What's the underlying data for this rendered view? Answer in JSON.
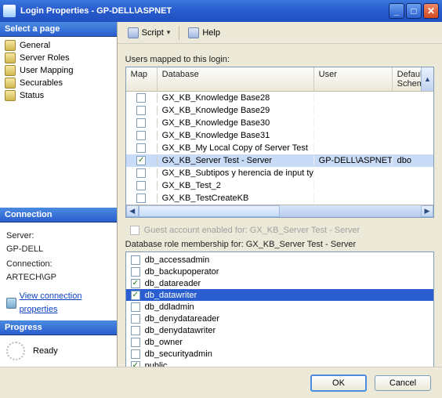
{
  "window": {
    "title": "Login Properties - GP-DELL\\ASPNET"
  },
  "sidebar": {
    "select_header": "Select a page",
    "items": [
      {
        "label": "General"
      },
      {
        "label": "Server Roles"
      },
      {
        "label": "User Mapping"
      },
      {
        "label": "Securables"
      },
      {
        "label": "Status"
      }
    ],
    "connection": {
      "header": "Connection",
      "server_label": "Server:",
      "server_value": "GP-DELL",
      "conn_label": "Connection:",
      "conn_value": "ARTECH\\GP",
      "view_props": "View connection properties"
    },
    "progress": {
      "header": "Progress",
      "status": "Ready"
    }
  },
  "toolbar": {
    "script": "Script",
    "help": "Help"
  },
  "main": {
    "mapped_label": "Users mapped to this login:",
    "columns": {
      "map": "Map",
      "database": "Database",
      "user": "User",
      "default_schema": "Default Schema"
    },
    "rows": [
      {
        "checked": false,
        "database": "GX_KB_Knowledge Base28",
        "user": "",
        "schema": "",
        "selected": false
      },
      {
        "checked": false,
        "database": "GX_KB_Knowledge Base29",
        "user": "",
        "schema": "",
        "selected": false
      },
      {
        "checked": false,
        "database": "GX_KB_Knowledge Base30",
        "user": "",
        "schema": "",
        "selected": false
      },
      {
        "checked": false,
        "database": "GX_KB_Knowledge Base31",
        "user": "",
        "schema": "",
        "selected": false
      },
      {
        "checked": false,
        "database": "GX_KB_My Local Copy of Server Test",
        "user": "",
        "schema": "",
        "selected": false
      },
      {
        "checked": true,
        "database": "GX_KB_Server Test - Server",
        "user": "GP-DELL\\ASPNET",
        "schema": "dbo",
        "selected": true
      },
      {
        "checked": false,
        "database": "GX_KB_Subtipos y herencia de input type",
        "user": "",
        "schema": "",
        "selected": false
      },
      {
        "checked": false,
        "database": "GX_KB_Test_2",
        "user": "",
        "schema": "",
        "selected": false
      },
      {
        "checked": false,
        "database": "GX_KB_TestCreateKB",
        "user": "",
        "schema": "",
        "selected": false
      }
    ],
    "guest_label": "Guest account enabled for: GX_KB_Server Test - Server",
    "roles_label": "Database role membership for: GX_KB_Server Test - Server",
    "roles": [
      {
        "checked": false,
        "name": "db_accessadmin",
        "selected": false
      },
      {
        "checked": false,
        "name": "db_backupoperator",
        "selected": false
      },
      {
        "checked": true,
        "name": "db_datareader",
        "selected": false
      },
      {
        "checked": true,
        "name": "db_datawriter",
        "selected": true
      },
      {
        "checked": false,
        "name": "db_ddladmin",
        "selected": false
      },
      {
        "checked": false,
        "name": "db_denydatareader",
        "selected": false
      },
      {
        "checked": false,
        "name": "db_denydatawriter",
        "selected": false
      },
      {
        "checked": false,
        "name": "db_owner",
        "selected": false
      },
      {
        "checked": false,
        "name": "db_securityadmin",
        "selected": false
      },
      {
        "checked": true,
        "name": "public",
        "selected": false
      }
    ]
  },
  "footer": {
    "ok": "OK",
    "cancel": "Cancel"
  }
}
